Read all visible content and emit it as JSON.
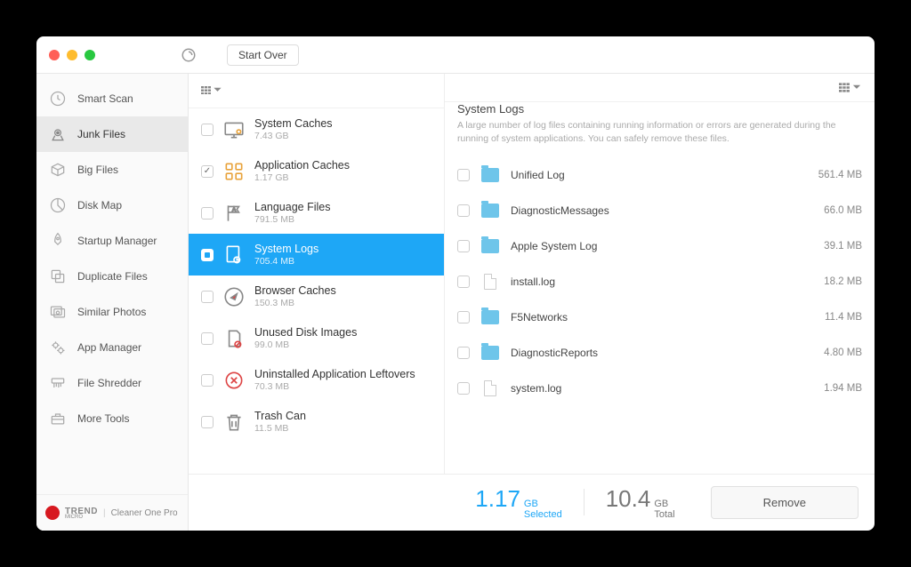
{
  "header": {
    "start_over": "Start Over"
  },
  "sidebar": {
    "items": [
      {
        "label": "Smart Scan",
        "icon": "clock"
      },
      {
        "label": "Junk Files",
        "icon": "vacuum",
        "active": true
      },
      {
        "label": "Big Files",
        "icon": "box"
      },
      {
        "label": "Disk Map",
        "icon": "pie"
      },
      {
        "label": "Startup Manager",
        "icon": "rocket"
      },
      {
        "label": "Duplicate Files",
        "icon": "dupes"
      },
      {
        "label": "Similar Photos",
        "icon": "photos"
      },
      {
        "label": "App Manager",
        "icon": "gears"
      },
      {
        "label": "File Shredder",
        "icon": "shredder"
      },
      {
        "label": "More Tools",
        "icon": "toolbox"
      }
    ],
    "footer_brand": "TREND",
    "footer_sub": "MICRO",
    "footer_product": "Cleaner One Pro"
  },
  "categories": [
    {
      "title": "System Caches",
      "size": "7.43 GB",
      "icon": "monitor",
      "check": "none"
    },
    {
      "title": "Application Caches",
      "size": "1.17 GB",
      "icon": "apps",
      "check": "checked"
    },
    {
      "title": "Language Files",
      "size": "791.5 MB",
      "icon": "flag",
      "check": "none"
    },
    {
      "title": "System Logs",
      "size": "705.4 MB",
      "icon": "logs",
      "check": "indeterminate",
      "active": true
    },
    {
      "title": "Browser Caches",
      "size": "150.3 MB",
      "icon": "compass",
      "check": "none"
    },
    {
      "title": "Unused Disk Images",
      "size": "99.0 MB",
      "icon": "disk",
      "check": "none"
    },
    {
      "title": "Uninstalled Application Leftovers",
      "size": "70.3 MB",
      "icon": "remove",
      "check": "none"
    },
    {
      "title": "Trash Can",
      "size": "11.5 MB",
      "icon": "trash",
      "check": "none"
    }
  ],
  "detail": {
    "title": "System Logs",
    "description": "A large number of log files containing running information or errors are generated during the running of system applications. You can safely remove these files.",
    "files": [
      {
        "name": "Unified Log",
        "size": "561.4 MB",
        "type": "folder"
      },
      {
        "name": "DiagnosticMessages",
        "size": "66.0 MB",
        "type": "folder"
      },
      {
        "name": "Apple System Log",
        "size": "39.1 MB",
        "type": "folder"
      },
      {
        "name": "install.log",
        "size": "18.2 MB",
        "type": "file"
      },
      {
        "name": "F5Networks",
        "size": "11.4 MB",
        "type": "folder"
      },
      {
        "name": "DiagnosticReports",
        "size": "4.80 MB",
        "type": "folder"
      },
      {
        "name": "system.log",
        "size": "1.94 MB",
        "type": "file"
      }
    ]
  },
  "footer": {
    "selected_value": "1.17",
    "selected_unit": "GB",
    "selected_label": "Selected",
    "total_value": "10.4",
    "total_unit": "GB",
    "total_label": "Total",
    "remove": "Remove"
  }
}
